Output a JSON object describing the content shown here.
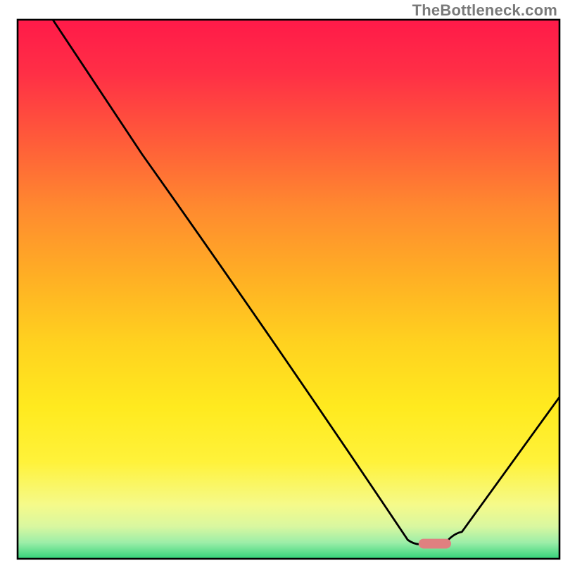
{
  "watermark": "TheBottleneck.com",
  "chart_data": {
    "type": "line",
    "title": "",
    "xlabel": "",
    "ylabel": "",
    "xlim": [
      0,
      100
    ],
    "ylim": [
      0,
      100
    ],
    "background_gradient": {
      "stops": [
        {
          "offset": 0.0,
          "color": "#ff1a49"
        },
        {
          "offset": 0.1,
          "color": "#ff2f46"
        },
        {
          "offset": 0.22,
          "color": "#ff5a3a"
        },
        {
          "offset": 0.35,
          "color": "#ff8a2f"
        },
        {
          "offset": 0.48,
          "color": "#ffb024"
        },
        {
          "offset": 0.6,
          "color": "#ffd21f"
        },
        {
          "offset": 0.72,
          "color": "#ffea1f"
        },
        {
          "offset": 0.82,
          "color": "#fff23a"
        },
        {
          "offset": 0.9,
          "color": "#f5fa8a"
        },
        {
          "offset": 0.94,
          "color": "#d9f7a0"
        },
        {
          "offset": 0.97,
          "color": "#9ceea8"
        },
        {
          "offset": 1.0,
          "color": "#33d27a"
        }
      ]
    },
    "series": [
      {
        "name": "bottleneck-curve",
        "color": "#000000",
        "width": 2.8,
        "points": [
          {
            "x": 6.5,
            "y": 100.0
          },
          {
            "x": 23.0,
            "y": 75.0
          },
          {
            "x": 72.0,
            "y": 3.5
          },
          {
            "x": 75.0,
            "y": 2.8
          },
          {
            "x": 79.0,
            "y": 3.0
          },
          {
            "x": 82.0,
            "y": 5.0
          },
          {
            "x": 100.0,
            "y": 30.0
          }
        ]
      }
    ],
    "markers": [
      {
        "name": "optimal-marker",
        "shape": "pill",
        "color": "#e08080",
        "x_center": 77.0,
        "y_center": 2.8,
        "width": 6.0,
        "height": 1.8
      }
    ],
    "plot_border": {
      "color": "#000000",
      "width": 2.6
    }
  }
}
